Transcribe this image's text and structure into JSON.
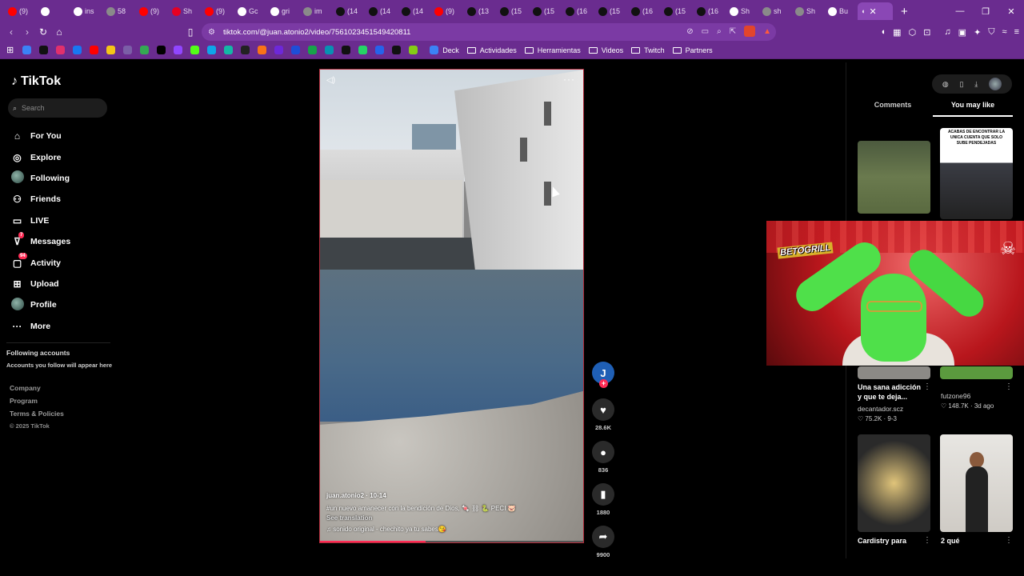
{
  "browser": {
    "tabs": [
      {
        "label": "(9)",
        "color": "#ff0000"
      },
      {
        "label": "",
        "color": "#ffffff"
      },
      {
        "label": "ins",
        "color": "#ffffff"
      },
      {
        "label": "58",
        "color": "#8a8a8a"
      },
      {
        "label": "(9)",
        "color": "#ff0000"
      },
      {
        "label": "Sh",
        "color": "#e60023"
      },
      {
        "label": "(9)",
        "color": "#ff0000"
      },
      {
        "label": "Gc",
        "color": "#ffffff"
      },
      {
        "label": "gri",
        "color": "#ffffff"
      },
      {
        "label": "im",
        "color": "#8a8a8a"
      },
      {
        "label": "(14",
        "color": "#111111"
      },
      {
        "label": "(14",
        "color": "#111111"
      },
      {
        "label": "(14",
        "color": "#111111"
      },
      {
        "label": "(9)",
        "color": "#ff0000"
      },
      {
        "label": "(13",
        "color": "#111111"
      },
      {
        "label": "(15",
        "color": "#111111"
      },
      {
        "label": "(15",
        "color": "#111111"
      },
      {
        "label": "(16",
        "color": "#111111"
      },
      {
        "label": "(15",
        "color": "#111111"
      },
      {
        "label": "(16",
        "color": "#111111"
      },
      {
        "label": "(15",
        "color": "#111111"
      },
      {
        "label": "(16",
        "color": "#111111"
      },
      {
        "label": "Sh",
        "color": "#ffffff"
      },
      {
        "label": "sh",
        "color": "#8a8a8a"
      },
      {
        "label": "Sh",
        "color": "#8a8a8a"
      },
      {
        "label": "Bu",
        "color": "#ffffff"
      }
    ],
    "active_tab_close": "✕",
    "new_tab": "+",
    "window_controls": [
      "—",
      "❐",
      "✕"
    ],
    "url": "tiktok.com/@juan.atonio2/video/7561023451549420811",
    "bookmarks": [
      {
        "label": "Deck"
      },
      {
        "label": "Actividades"
      },
      {
        "label": "Herramientas"
      },
      {
        "label": "Videos"
      },
      {
        "label": "Twitch"
      },
      {
        "label": "Partners"
      }
    ],
    "accent": "#6a2c8f"
  },
  "sidebar": {
    "logo": "TikTok",
    "search_placeholder": "Search",
    "nav": [
      {
        "label": "For You",
        "icon": "home-icon",
        "glyph": "⌂"
      },
      {
        "label": "Explore",
        "icon": "compass-icon",
        "glyph": "◎"
      },
      {
        "label": "Following",
        "icon": "following-avatar-icon",
        "glyph": ""
      },
      {
        "label": "Friends",
        "icon": "friends-icon",
        "glyph": "⚇"
      },
      {
        "label": "LIVE",
        "icon": "live-icon",
        "glyph": "▭"
      },
      {
        "label": "Messages",
        "icon": "messages-icon",
        "glyph": "⊽",
        "badge": "7"
      },
      {
        "label": "Activity",
        "icon": "activity-icon",
        "glyph": "▢",
        "badge": "94"
      },
      {
        "label": "Upload",
        "icon": "upload-icon",
        "glyph": "⊞"
      },
      {
        "label": "Profile",
        "icon": "profile-avatar-icon",
        "glyph": ""
      },
      {
        "label": "More",
        "icon": "more-icon",
        "glyph": "···"
      }
    ],
    "following_title": "Following accounts",
    "following_sub": "Accounts you follow will appear here",
    "footer": [
      "Company",
      "Program",
      "Terms & Policies"
    ],
    "copyright": "© 2025 TikTok"
  },
  "video": {
    "author_line": "juan.atonio2 · 10-14",
    "description": "#un  nuevo amanecer con la bendición de Dios, 🍬 ⛓ 🐍 PECI 🐷",
    "see_translation": "See translation",
    "sound": "♫ sonido original - chechito ya tu sabes😘",
    "progress": 0.4
  },
  "actions": {
    "author_initial": "J",
    "likes": "28.6K",
    "comments": "836",
    "saves": "1880",
    "shares": "9900"
  },
  "right_panel": {
    "tabs": [
      "Comments",
      "You may like"
    ],
    "selected_tab": "You may like",
    "thumb2_text": "ACABAS DE ENCONTRAR LA UNICA CUENTA QUE SOLO SUBE PENDEJADAS",
    "cards": [
      {
        "title": "Una sana adicción y que te deja...",
        "author": "decantador.scz",
        "meta": "♡ 75.2K · 9-3"
      },
      {
        "title": "",
        "author": "futzone96",
        "meta": "♡ 148.7K · 3d ago"
      },
      {
        "title": "Cardistry para",
        "author": "",
        "meta": ""
      },
      {
        "title": "2 qué",
        "author": "",
        "meta": ""
      }
    ]
  },
  "webcam": {
    "logo_text": "BETOGRILL"
  }
}
